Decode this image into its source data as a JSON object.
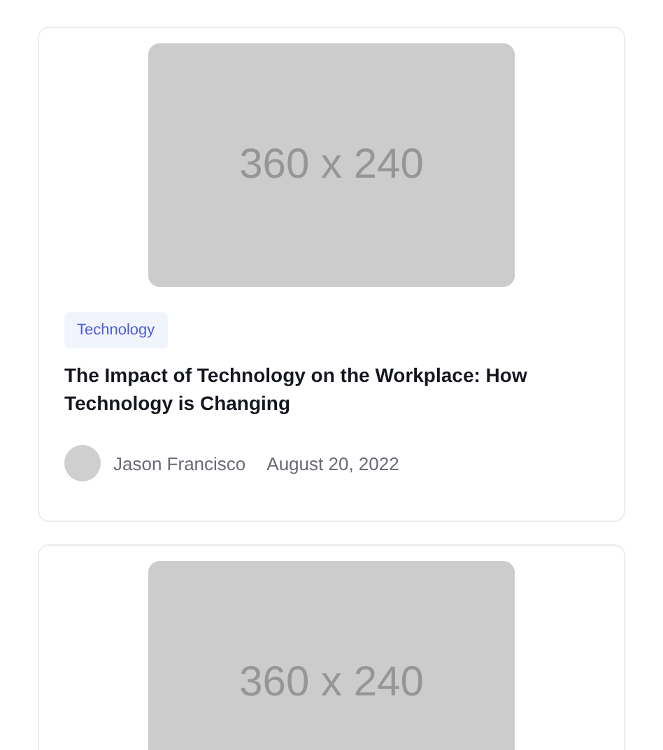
{
  "posts": [
    {
      "image_text": "360 x 240",
      "category": "Technology",
      "title": "The Impact of Technology on the Workplace: How Technology is Changing",
      "author": "Jason Francisco",
      "date": "August 20, 2022"
    },
    {
      "image_text": "360 x 240"
    }
  ]
}
